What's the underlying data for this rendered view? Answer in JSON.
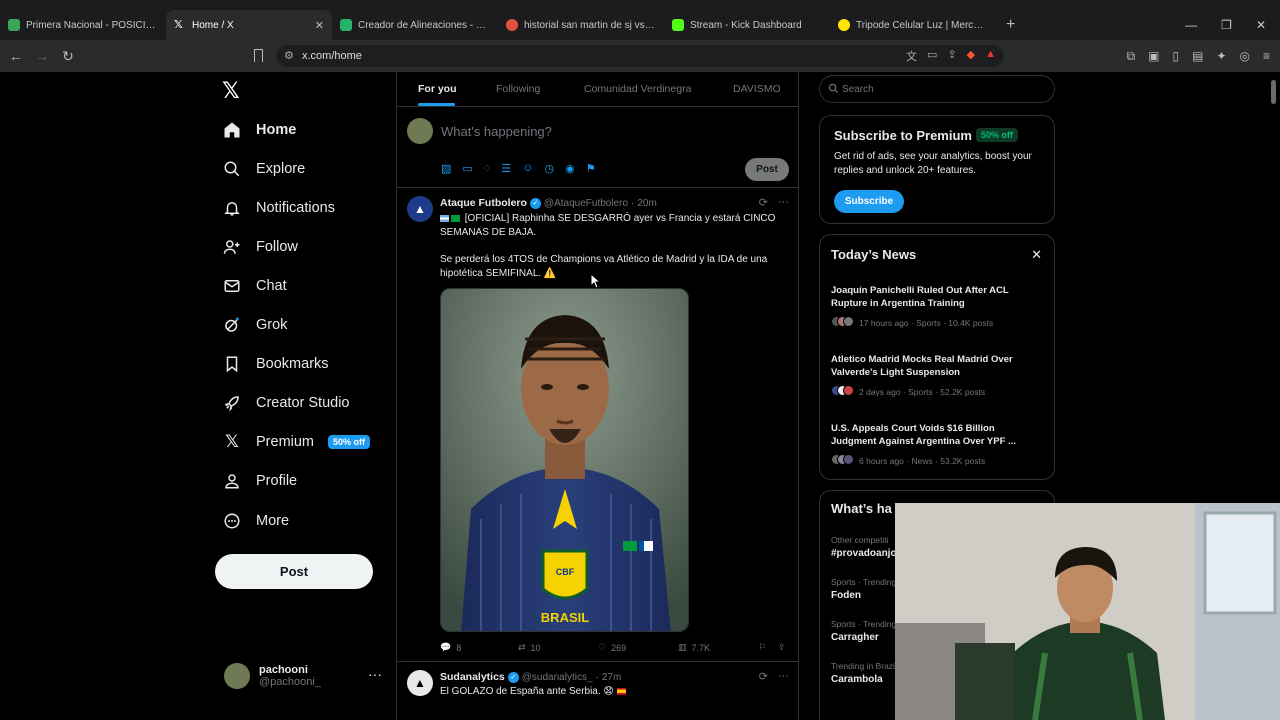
{
  "browser": {
    "tabs": [
      {
        "title": "Primera Nacional - POSICIONES, RES",
        "favicon_color": "#3aa655"
      },
      {
        "title": "Home / X",
        "favicon_color": "#ffffff"
      },
      {
        "title": "Creador de Alineaciones - Forma tu E",
        "favicon_color": "#25b36b"
      },
      {
        "title": "historial san martin de sj vs racing cl",
        "favicon_color": "#e0503d"
      },
      {
        "title": "Stream - Kick Dashboard",
        "favicon_color": "#53fc18"
      },
      {
        "title": "Tripode Celular Luz | MercadoLibre",
        "favicon_color": "#ffe600"
      }
    ],
    "url": "x.com/home"
  },
  "sidebar": {
    "items": [
      {
        "label": "Home"
      },
      {
        "label": "Explore"
      },
      {
        "label": "Notifications"
      },
      {
        "label": "Follow"
      },
      {
        "label": "Chat"
      },
      {
        "label": "Grok"
      },
      {
        "label": "Bookmarks"
      },
      {
        "label": "Creator Studio"
      },
      {
        "label": "Premium",
        "badge": "50% off"
      },
      {
        "label": "Profile"
      },
      {
        "label": "More"
      }
    ],
    "post_label": "Post",
    "account": {
      "name": "pachooni",
      "handle": "@pachooni_"
    }
  },
  "timeline": {
    "tabs": [
      "For you",
      "Following",
      "Comunidad Verdinegra",
      "DAVISMO"
    ],
    "composer": {
      "placeholder": "What's happening?",
      "post_label": "Post"
    },
    "tweets": [
      {
        "name": "Ataque Futbolero",
        "handle": "@AtaqueFutbolero",
        "time": "20m",
        "text1": "[OFICIAL] Raphinha SE DESGARRÓ ayer vs Francia y estará CINCO SEMANAS DE BAJA.",
        "text2": "Se perderá los 4TOS de Champions va Atlético de Madrid y la IDA de una hipotética SEMIFINAL. ⚠️",
        "replies": "8",
        "reposts": "10",
        "likes": "269",
        "views": "7.7K",
        "media_text": "BRASIL",
        "media_badge": "CBF"
      },
      {
        "name": "Sudanalytics",
        "handle": "@sudanalytics_",
        "time": "27m",
        "text1": "El GOLAZO de España ante Serbia. 😧"
      }
    ]
  },
  "right": {
    "search_placeholder": "Search",
    "premium": {
      "title": "Subscribe to Premium",
      "badge": "50% off",
      "desc": "Get rid of ads, see your analytics, boost your replies and unlock 20+ features.",
      "button": "Subscribe"
    },
    "news": {
      "title": "Today’s News",
      "items": [
        {
          "title": "Joaquín Panichelli Ruled Out After ACL Rupture in Argentina Training",
          "meta": "17 hours ago · Sports · 10.4K posts"
        },
        {
          "title": "Atletico Madrid Mocks Real Madrid Over Valverde's Light Suspension",
          "meta": "2 days ago · Sports · 52.2K posts"
        },
        {
          "title": "U.S. Appeals Court Voids $16 Billion Judgment Against Argentina Over YPF ...",
          "meta": "6 hours ago · News · 53.2K posts"
        }
      ]
    },
    "happening": {
      "title": "What’s ha",
      "items": [
        {
          "meta": "Other competiti",
          "topic": "#provadoanjo"
        },
        {
          "meta": "Sports · Trending",
          "topic": "Foden"
        },
        {
          "meta": "Sports · Trending",
          "topic": "Carragher"
        },
        {
          "meta": "Trending in Brazi",
          "topic": "Carambola"
        }
      ]
    }
  },
  "colors": {
    "accent": "#1d9bf0",
    "background": "#000000",
    "border": "#2f3336",
    "muted": "#71767b"
  }
}
